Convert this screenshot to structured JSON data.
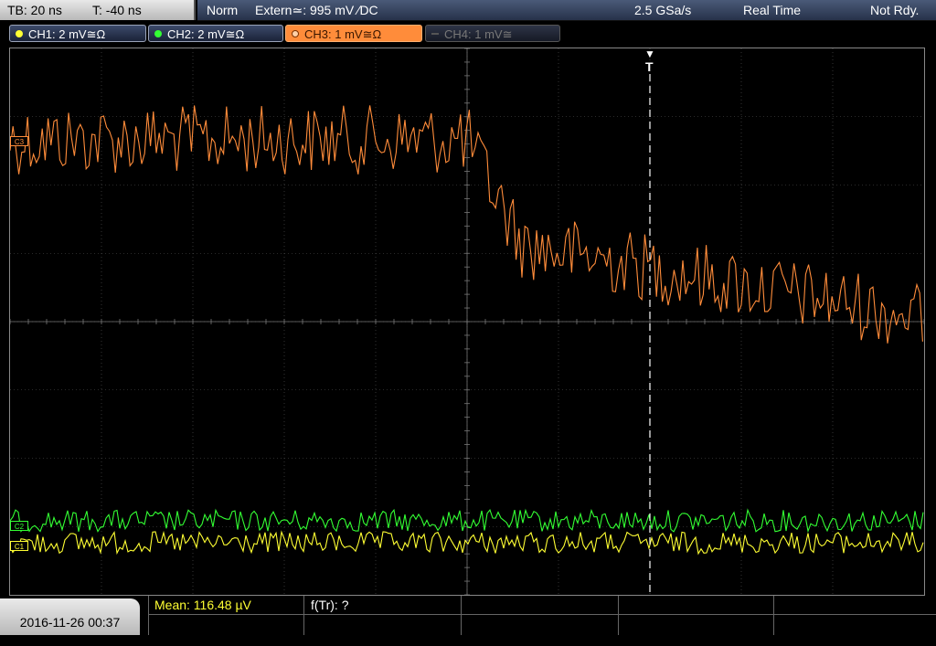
{
  "top": {
    "timebase": "TB: 20 ns",
    "trigger_time": "T: -40 ns",
    "trigger_mode": "Norm",
    "trigger_source": "Extern≃: 995 mV ∕DC",
    "sample_rate": "2.5 GSa/s",
    "acq_mode": "Real Time",
    "status": "Not Rdy."
  },
  "channels": [
    {
      "label": "CH1: 2 mV≅Ω",
      "color": "#ffff33",
      "active": true
    },
    {
      "label": "CH2: 2 mV≅Ω",
      "color": "#33ff33",
      "active": true
    },
    {
      "label": "CH3: 1 mV≅Ω",
      "color": "#ff8c3a",
      "active": true
    },
    {
      "label": "CH4: 1 mV≅",
      "color": "#666666",
      "active": false
    }
  ],
  "markers": {
    "ch3": "C3",
    "ch2": "C2",
    "ch1": "C1",
    "trigger": "T"
  },
  "bottom": {
    "datetime": "2016-11-26 00:37",
    "mean": "Mean: 116.48 µV",
    "ftr": "f(Tr): ?"
  },
  "colors": {
    "ch1": "#ffff33",
    "ch2": "#33ff33",
    "ch3": "#ff8c3a",
    "grid": "#555555"
  }
}
